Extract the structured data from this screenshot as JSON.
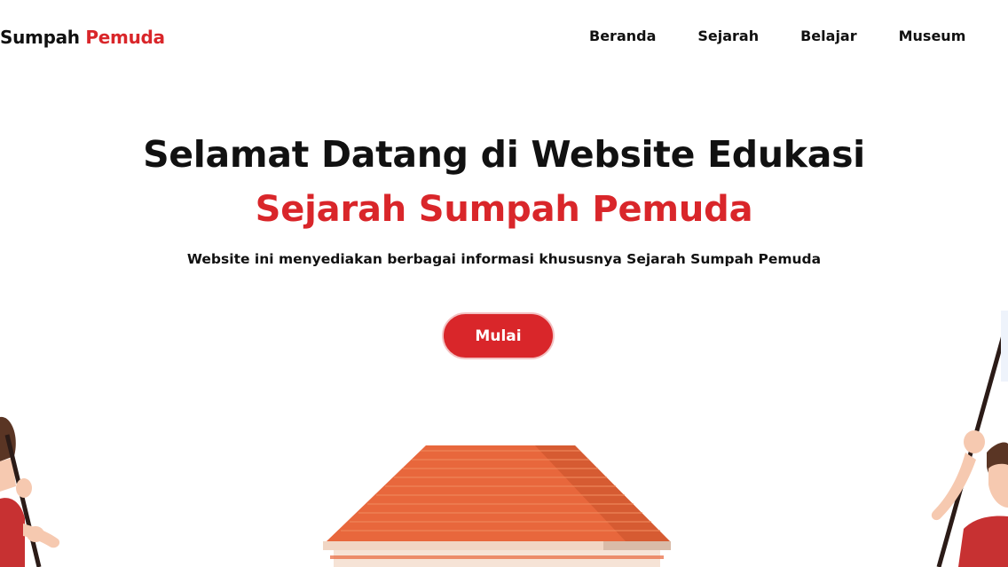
{
  "nav": {
    "logo_primary": "Sumpah",
    "logo_accent": "Pemuda",
    "links": [
      "Beranda",
      "Sejarah",
      "Belajar",
      "Museum"
    ]
  },
  "hero": {
    "title": "Selamat Datang di Website Edukasi",
    "subtitle": "Sejarah Sumpah Pemuda",
    "description": "Website ini menyediakan berbagai informasi khususnya Sejarah Sumpah Pemuda",
    "cta_label": "Mulai"
  },
  "colors": {
    "accent": "#d9262a",
    "text": "#111111",
    "roof": "#e8673c",
    "skin": "#f6c9b0"
  },
  "icons": [
    "building-illustration",
    "youth-left-illustration",
    "youth-right-illustration"
  ]
}
